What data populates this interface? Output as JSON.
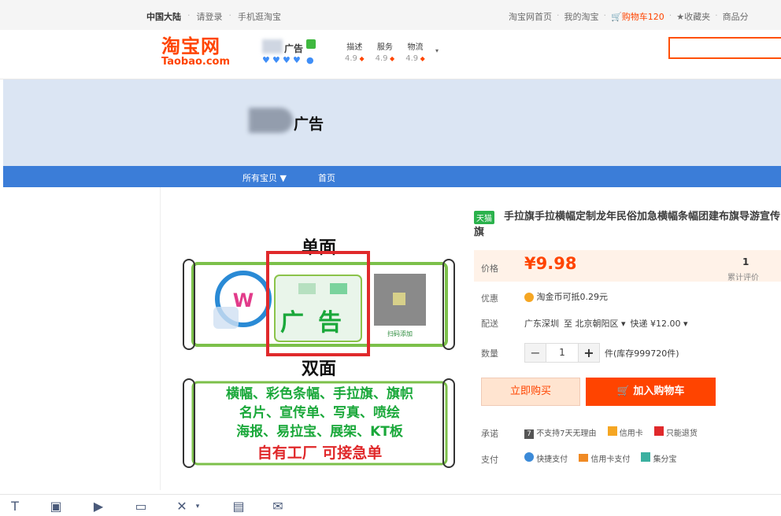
{
  "topbar": {
    "region": "中国大陆",
    "login": "请登录",
    "mobile": "手机逛淘宝",
    "home": "淘宝网首页",
    "mytaobao": "我的淘宝",
    "cart": "购物车",
    "cart_count": "120",
    "favorites": "收藏夹",
    "more": "商品分"
  },
  "header": {
    "logo_cn": "淘宝网",
    "logo_en": "Taobao.com",
    "shop_name": "广告",
    "scores": [
      {
        "label": "描述",
        "value": "4.9"
      },
      {
        "label": "服务",
        "value": "4.9"
      },
      {
        "label": "物流",
        "value": "4.9"
      }
    ]
  },
  "banner": {
    "text": "广告"
  },
  "nav": {
    "items": [
      "所有宝贝",
      "首页"
    ]
  },
  "product": {
    "tag": "天猫",
    "title": "手拉旗手拉横幅定制龙年民俗加急横幅条幅团建布旗导游宣传旗",
    "price_label": "价格",
    "price": "¥9.98",
    "review_count": "1",
    "review_label": "累计评价",
    "promo_label": "优惠",
    "promo_text": "淘金币可抵0.29元",
    "ship_label": "配送",
    "ship_from": "广东深圳",
    "ship_to": "至 北京朝阳区",
    "ship_fee": "快递 ¥12.00",
    "qty_label": "数量",
    "qty": "1",
    "stock": "件(库存999720件)",
    "buy_now": "立即购买",
    "add_cart": "加入购物车",
    "promise_label": "承诺",
    "promises": [
      "不支持7天无理由",
      "信用卡",
      "只能退货"
    ],
    "pay_label": "支付",
    "payments": [
      "快捷支付",
      "信用卡支付",
      "集分宝"
    ]
  },
  "image": {
    "top_label": "单面",
    "mid_label": "双面",
    "ad_text": "广告",
    "qr_caption": "扫码添加",
    "lines": [
      "横幅、彩色条幅、手拉旗、旗帜",
      "名片、宣传单、写真、喷绘",
      "海报、易拉宝、展架、KT板"
    ],
    "slogan": "自有工厂 可接急单"
  },
  "toolbar": {
    "icons": [
      "text-icon",
      "image-icon",
      "video-icon",
      "folder-icon",
      "cut-icon",
      "table-icon",
      "mail-icon"
    ]
  }
}
